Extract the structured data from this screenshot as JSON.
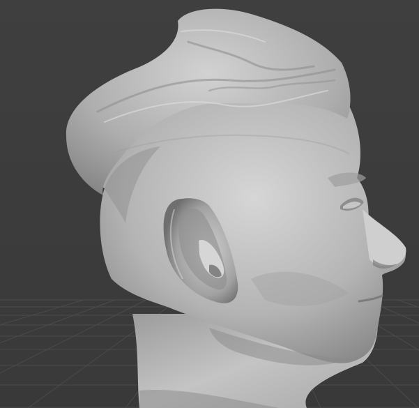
{
  "viewport": {
    "background_color": "#3d3d3d",
    "grid_color": "#4a4a4a",
    "mesh_base_color": "#b8b8b8",
    "mesh_shadow_color": "#6e6e6e",
    "mesh_highlight_color": "#dcdcdc"
  },
  "scene": {
    "object": "sculpted-head-bust",
    "view": "three-quarter-side",
    "shading": "solid-matcap-gray",
    "grid_floor": true
  }
}
